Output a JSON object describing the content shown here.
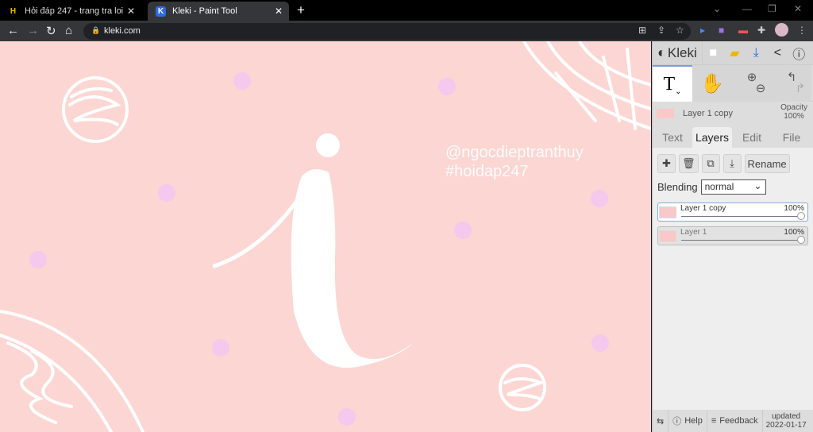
{
  "browser": {
    "tabs": [
      {
        "title": "Hỏi đáp 247 - trang tra loi",
        "favicon": "H"
      },
      {
        "title": "Kleki - Paint Tool",
        "favicon": "K"
      }
    ],
    "url": "kleki.com"
  },
  "canvas": {
    "watermark_line1": "@ngocdieptranthuy",
    "watermark_line2": "#hoidap247",
    "background": "#fcd6d3"
  },
  "panel": {
    "logo": "Kleki",
    "current_layer": "Layer 1 copy",
    "opacity_label": "Opacity",
    "opacity_value": "100%",
    "tabs": [
      "Text",
      "Layers",
      "Edit",
      "File"
    ],
    "active_tab": "Layers",
    "rename": "Rename",
    "blending_label": "Blending",
    "blending_value": "normal",
    "layers": [
      {
        "name": "Layer 1 copy",
        "opacity": "100%",
        "active": true
      },
      {
        "name": "Layer 1",
        "opacity": "100%",
        "active": false
      }
    ],
    "footer": {
      "help": "Help",
      "feedback": "Feedback",
      "updated_label": "updated",
      "updated_date": "2022-01-17"
    }
  }
}
